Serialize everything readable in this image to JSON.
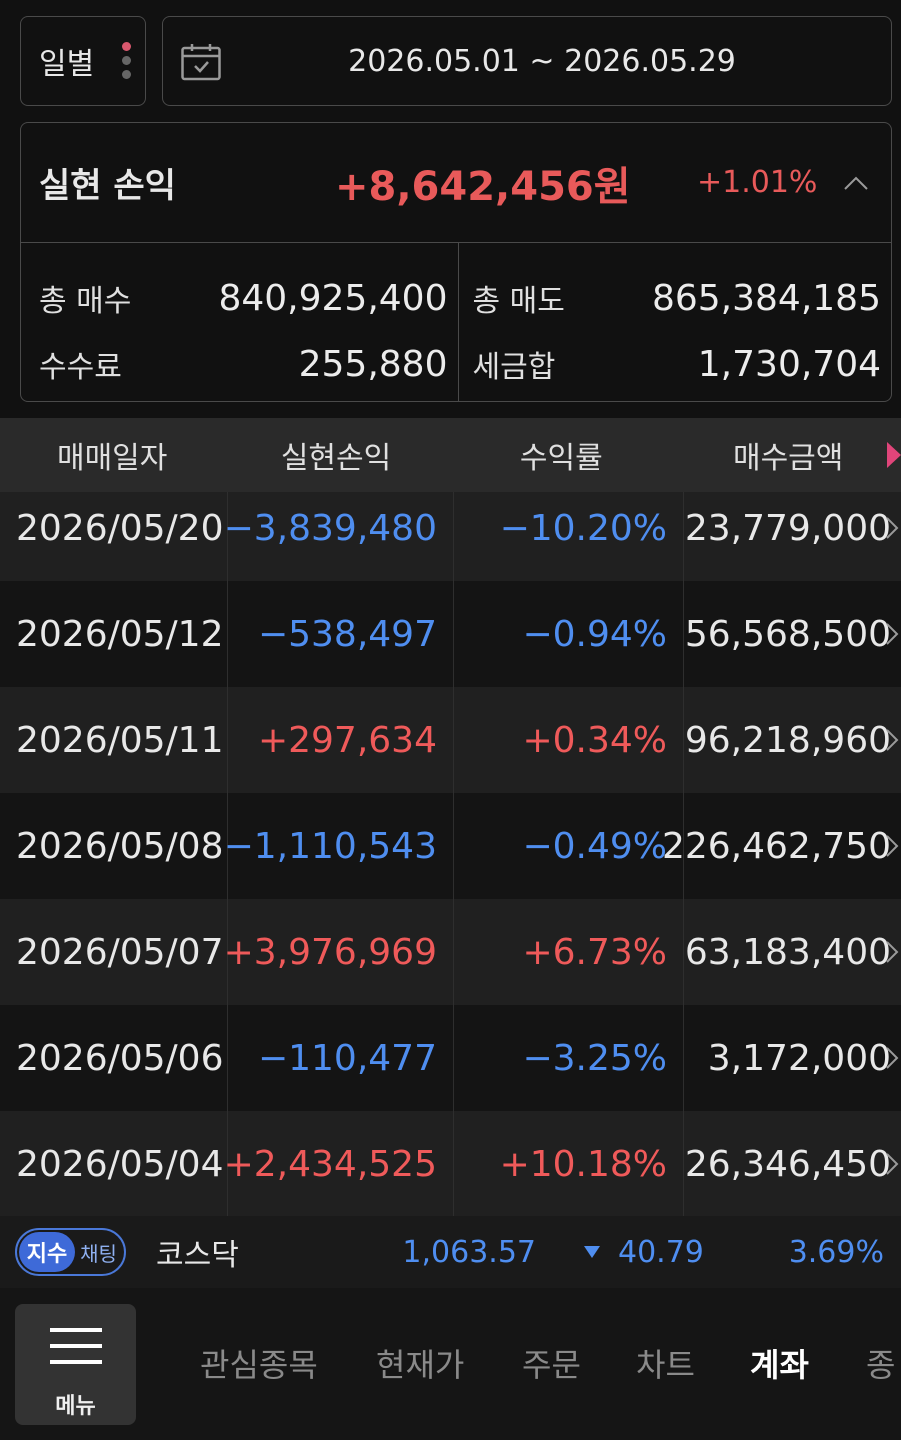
{
  "filter": {
    "period_label": "일별",
    "date_range": "2026.05.01 ~ 2026.05.29"
  },
  "summary": {
    "title": "실현 손익",
    "amount": "+8,642,456원",
    "rate": "+1.01%",
    "total_buy_label": "총 매수",
    "total_buy_value": "840,925,400",
    "total_sell_label": "총 매도",
    "total_sell_value": "865,384,185",
    "fee_label": "수수료",
    "fee_value": "255,880",
    "tax_label": "세금합",
    "tax_value": "1,730,704"
  },
  "table": {
    "headers": [
      "매매일자",
      "실현손익",
      "수익률",
      "매수금액"
    ],
    "rows": [
      {
        "date": "2026/05/20",
        "pnl": "−3,839,480",
        "rate": "−10.20%",
        "buy": "23,779,000",
        "sign": "neg"
      },
      {
        "date": "2026/05/12",
        "pnl": "−538,497",
        "rate": "−0.94%",
        "buy": "56,568,500",
        "sign": "neg"
      },
      {
        "date": "2026/05/11",
        "pnl": "+297,634",
        "rate": "+0.34%",
        "buy": "96,218,960",
        "sign": "pos"
      },
      {
        "date": "2026/05/08",
        "pnl": "−1,110,543",
        "rate": "−0.49%",
        "buy": "226,462,750",
        "sign": "neg"
      },
      {
        "date": "2026/05/07",
        "pnl": "+3,976,969",
        "rate": "+6.73%",
        "buy": "63,183,400",
        "sign": "pos"
      },
      {
        "date": "2026/05/06",
        "pnl": "−110,477",
        "rate": "−3.25%",
        "buy": "3,172,000",
        "sign": "neg"
      },
      {
        "date": "2026/05/04",
        "pnl": "+2,434,525",
        "rate": "+10.18%",
        "buy": "26,346,450",
        "sign": "pos"
      }
    ]
  },
  "ticker": {
    "pill_on": "지수",
    "pill_off": "채팅",
    "name": "코스닥",
    "price": "1,063.57",
    "change": "40.79",
    "rate": "3.69%"
  },
  "nav": {
    "menu_label": "메뉴",
    "tabs": [
      "관심종목",
      "현재가",
      "주문",
      "차트",
      "계좌",
      "종"
    ]
  },
  "colors": {
    "positive": "#ef5a5a",
    "negative": "#4f8ef0",
    "accent_pink": "#e0457a",
    "background": "#111111"
  },
  "icons": {
    "calendar": "calendar-check-icon",
    "collapse": "chevron-up-icon",
    "more_columns": "triangle-right-icon",
    "row_detail": "chevron-right-icon",
    "down": "triangle-down-icon",
    "menu": "hamburger-icon"
  }
}
